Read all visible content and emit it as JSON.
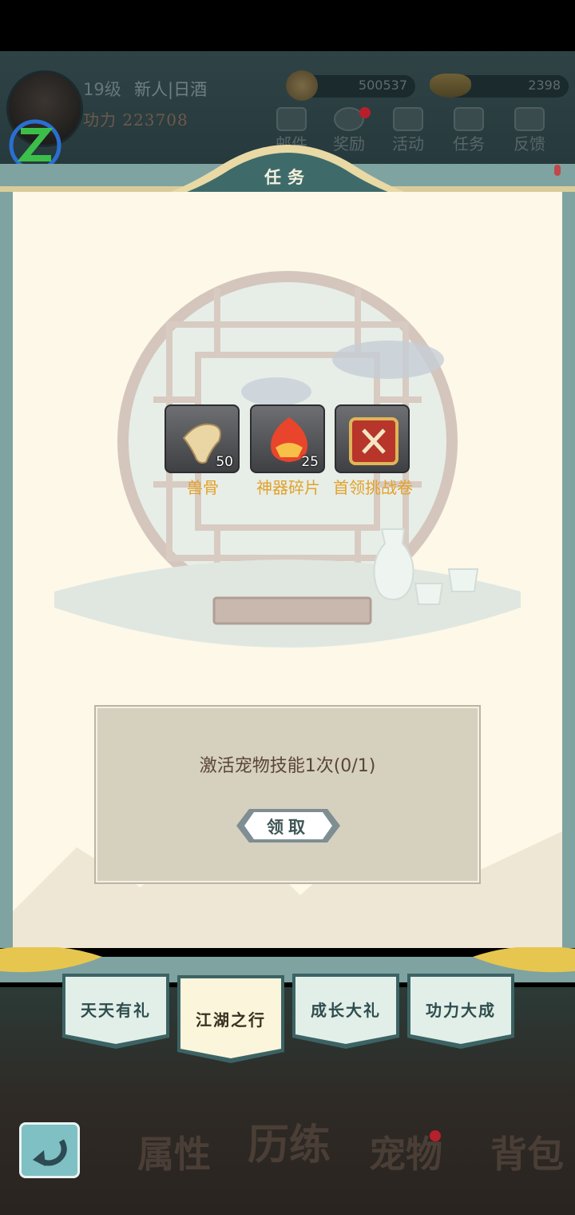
{
  "header": {
    "level": "19级",
    "player_name": "新人|日酒",
    "power": "功力 223708",
    "coins": "500537",
    "gold": "2398",
    "nav": [
      {
        "label": "邮件",
        "icon": "mail-icon",
        "badge": false
      },
      {
        "label": "奖励",
        "icon": "clock-icon",
        "badge": true
      },
      {
        "label": "活动",
        "icon": "chest-icon",
        "badge": false
      },
      {
        "label": "任务",
        "icon": "scroll-icon",
        "badge": false
      },
      {
        "label": "反馈",
        "icon": "note-icon",
        "badge": false
      }
    ]
  },
  "panel": {
    "title": "任务"
  },
  "rewards": [
    {
      "name": "兽骨",
      "qty": "50",
      "icon": "beast-bone-icon"
    },
    {
      "name": "神器碎片",
      "qty": "25",
      "icon": "artifact-shard-icon"
    },
    {
      "name": "首领挑战卷",
      "qty": "",
      "icon": "boss-challenge-scroll-icon"
    }
  ],
  "task": {
    "description": "激活宠物技能1次(0/1)",
    "claim_label": "领取"
  },
  "tabs": [
    {
      "label": "天天有礼",
      "active": false
    },
    {
      "label": "江湖之行",
      "active": true
    },
    {
      "label": "成长大礼",
      "active": false
    },
    {
      "label": "功力大成",
      "active": false
    }
  ],
  "bottom_nav": [
    {
      "label": "属性"
    },
    {
      "label": "历练"
    },
    {
      "label": "宠物",
      "badge": true
    },
    {
      "label": "背包"
    }
  ],
  "colors": {
    "frame": "#7fa3a1",
    "panel_bg": "#fdf8e8",
    "reward_name": "#e3a12a",
    "task_text": "#5a4636",
    "badge": "#b7202a"
  }
}
